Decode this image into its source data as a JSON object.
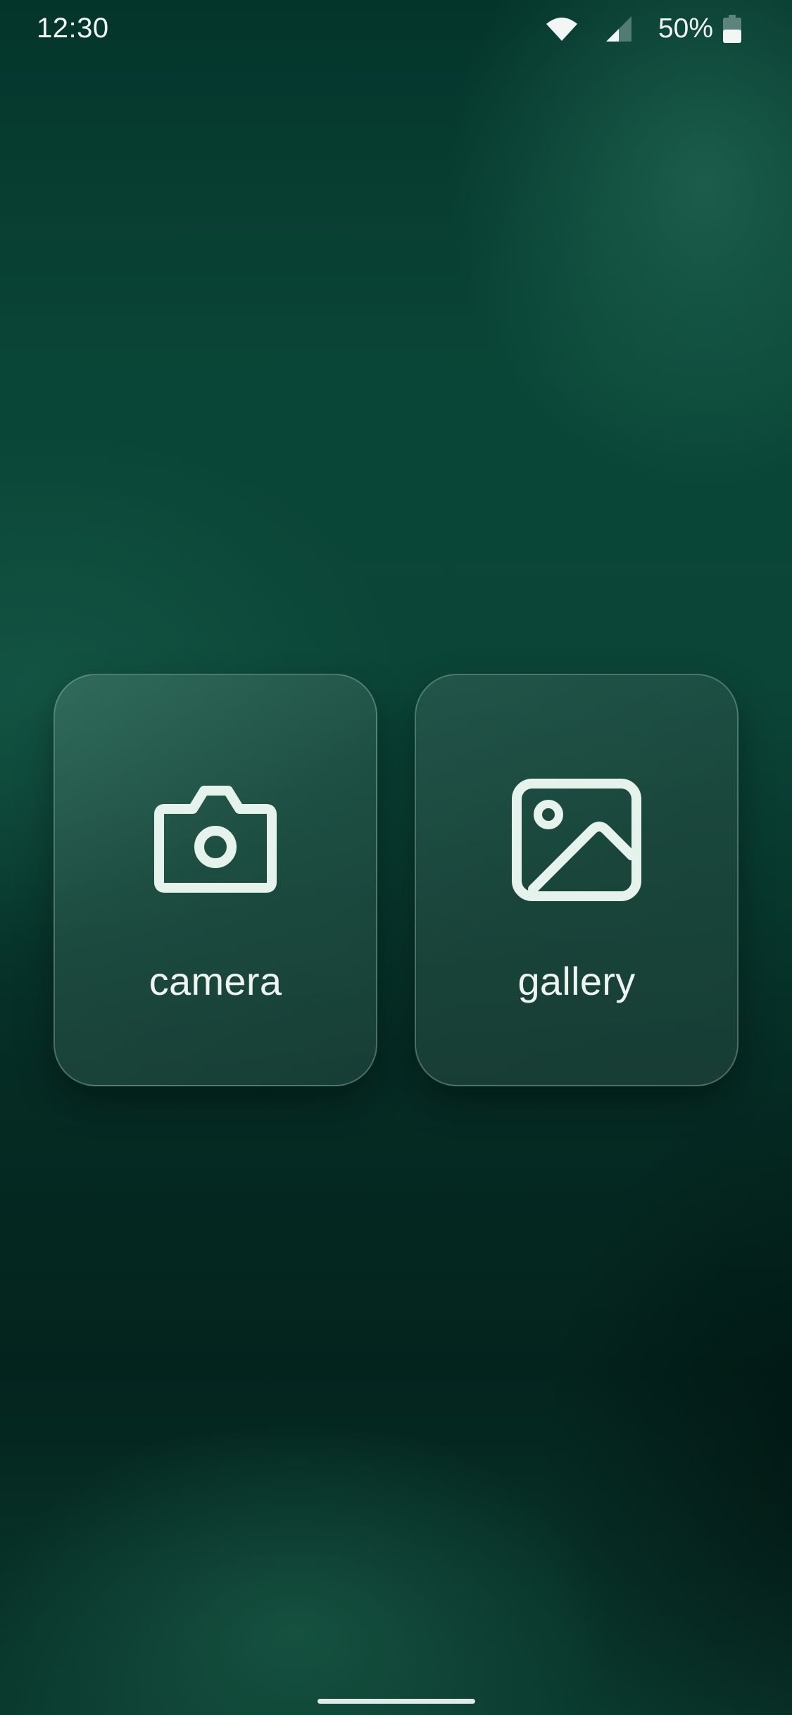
{
  "status_bar": {
    "time": "12:30",
    "battery_percent": "50%",
    "icons": [
      "wifi-icon",
      "cellular-signal-icon",
      "battery-icon"
    ]
  },
  "actions": {
    "camera": {
      "label": "camera",
      "icon": "camera-icon"
    },
    "gallery": {
      "label": "gallery",
      "icon": "image-icon"
    }
  },
  "colors": {
    "icon_and_text": "#e6f2ec",
    "background_dark": "#03241e",
    "background_mid": "#0b4537"
  }
}
